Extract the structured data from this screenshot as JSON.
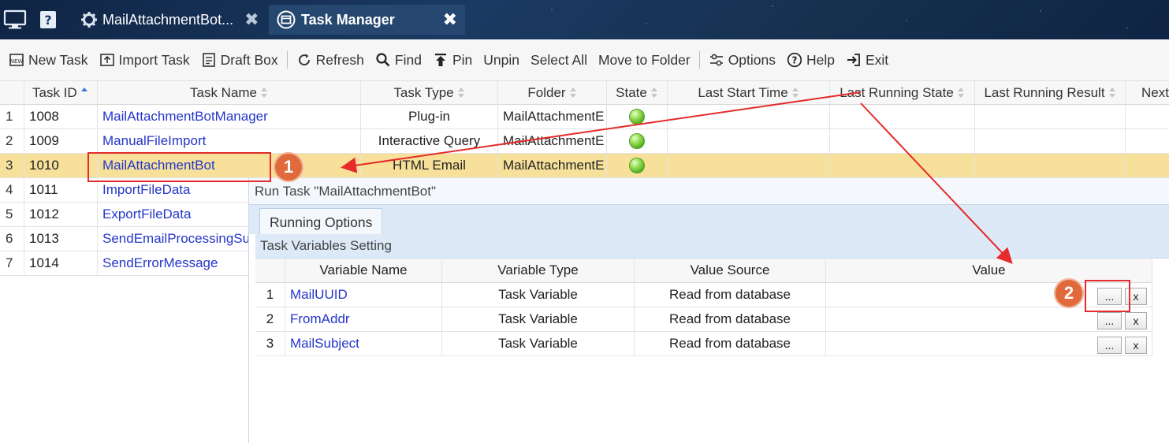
{
  "tabs": {
    "session_tab_label": "MailAttachmentBot...",
    "active_tab_label": "Task Manager",
    "close_glyph": "✖"
  },
  "toolbar": {
    "new_task": "New Task",
    "import_task": "Import Task",
    "draft_box": "Draft Box",
    "refresh": "Refresh",
    "find": "Find",
    "pin": "Pin",
    "unpin": "Unpin",
    "select_all": "Select All",
    "move_to_folder": "Move to Folder",
    "options": "Options",
    "help": "Help",
    "exit": "Exit"
  },
  "grid": {
    "headers": {
      "task_id": "Task ID",
      "task_name": "Task Name",
      "task_type": "Task Type",
      "folder": "Folder",
      "state": "State",
      "last_start_time": "Last Start Time",
      "last_running_state": "Last Running State",
      "last_running_result": "Last Running Result",
      "next": "Next"
    },
    "rows": [
      {
        "num": "1",
        "id": "1008",
        "name": "MailAttachmentBotManager",
        "type": "Plug-in",
        "folder": "MailAttachmentE"
      },
      {
        "num": "2",
        "id": "1009",
        "name": "ManualFileImport",
        "type": "Interactive Query",
        "folder": "MailAttachmentE"
      },
      {
        "num": "3",
        "id": "1010",
        "name": "MailAttachmentBot",
        "type": "HTML Email",
        "folder": "MailAttachmentE"
      },
      {
        "num": "4",
        "id": "1011",
        "name": "ImportFileData"
      },
      {
        "num": "5",
        "id": "1012",
        "name": "ExportFileData"
      },
      {
        "num": "6",
        "id": "1013",
        "name": "SendEmailProcessingSu"
      },
      {
        "num": "7",
        "id": "1014",
        "name": "SendErrorMessage"
      }
    ]
  },
  "run_panel": {
    "title": "Run Task \"MailAttachmentBot\"",
    "tab_label": "Running Options",
    "section_label": "Task Variables Setting",
    "headers": {
      "variable_name": "Variable Name",
      "variable_type": "Variable Type",
      "value_source": "Value Source",
      "value": "Value"
    },
    "rows": [
      {
        "num": "1",
        "name": "MailUUID",
        "type": "Task Variable",
        "source": "Read from database",
        "browse": "...",
        "clear": "x"
      },
      {
        "num": "2",
        "name": "FromAddr",
        "type": "Task Variable",
        "source": "Read from database",
        "browse": "...",
        "clear": "x"
      },
      {
        "num": "3",
        "name": "MailSubject",
        "type": "Task Variable",
        "source": "Read from database",
        "browse": "...",
        "clear": "x"
      }
    ]
  },
  "annotations": {
    "badge_1": "1",
    "badge_2": "2",
    "color": "#e52b2b"
  }
}
